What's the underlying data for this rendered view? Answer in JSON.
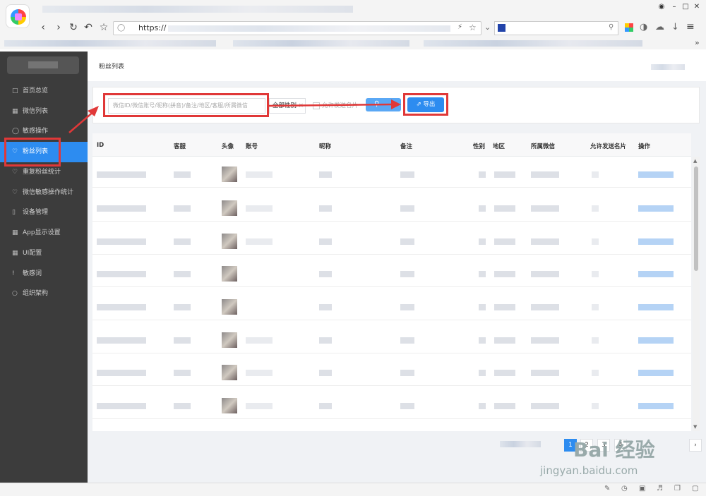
{
  "browser": {
    "url_prefix": "https://",
    "window_controls": [
      "–",
      "□",
      "✕"
    ]
  },
  "sidebar": {
    "items": [
      {
        "label": "首页总览",
        "icon": "home-icon",
        "active": false
      },
      {
        "label": "微信列表",
        "icon": "grid-icon",
        "active": false
      },
      {
        "label": "敏感操作",
        "icon": "shield-icon",
        "active": false
      },
      {
        "label": "粉丝列表",
        "icon": "heart-icon",
        "active": true
      },
      {
        "label": "重复粉丝统计",
        "icon": "heart-icon",
        "active": false
      },
      {
        "label": "微信敏感操作统计",
        "icon": "heart-icon",
        "active": false
      },
      {
        "label": "设备管理",
        "icon": "phone-icon",
        "active": false
      },
      {
        "label": "App显示设置",
        "icon": "grid-icon",
        "active": false
      },
      {
        "label": "UI配置",
        "icon": "grid-icon",
        "active": false
      },
      {
        "label": "敏感词",
        "icon": "exclamation-icon",
        "active": false
      },
      {
        "label": "组织架构",
        "icon": "user-icon",
        "active": false
      }
    ]
  },
  "breadcrumb": "粉丝列表",
  "toolbar": {
    "search_placeholder": "微信ID/微信账号/昵称(拼音)/备注/地区/客服/所属微信",
    "gender_select": "全部性别",
    "allow_card_label": "允许发送名片",
    "export_label": "导出",
    "accent": "#2d8cf0"
  },
  "table": {
    "columns": [
      "ID",
      "客服",
      "头像",
      "账号",
      "昵称",
      "备注",
      "性别",
      "地区",
      "所属微信",
      "允许发送名片",
      "操作"
    ]
  },
  "pagination": {
    "pages": [
      "1",
      "2",
      "3",
      "4"
    ],
    "current": "1",
    "next": "›"
  },
  "watermark": {
    "main": "Bai  经验",
    "sub": "jingyan.baidu.com"
  }
}
